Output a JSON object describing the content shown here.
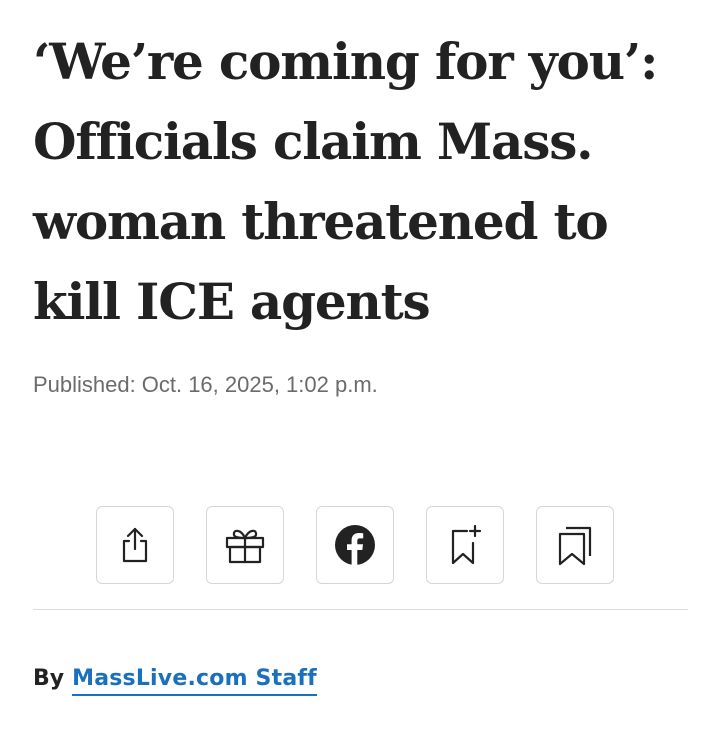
{
  "article": {
    "headline": "‘We’re coming for you’: Officials claim Mass. woman threatened to kill ICE agents",
    "published_label": "Published:",
    "published_date": "Oct. 16, 2025, 1:02 p.m."
  },
  "share_bar": {
    "buttons": [
      {
        "name": "share",
        "icon": "share-icon"
      },
      {
        "name": "gift",
        "icon": "gift-icon"
      },
      {
        "name": "facebook",
        "icon": "facebook-icon"
      },
      {
        "name": "bookmark-add",
        "icon": "bookmark-add-icon"
      },
      {
        "name": "saved",
        "icon": "bookmarks-icon"
      }
    ]
  },
  "byline": {
    "prefix": "By",
    "author": "MassLive.com Staff"
  },
  "colors": {
    "text": "#222222",
    "muted": "#6b6b6b",
    "link": "#1a6fbf",
    "border": "#d6d6d6"
  }
}
